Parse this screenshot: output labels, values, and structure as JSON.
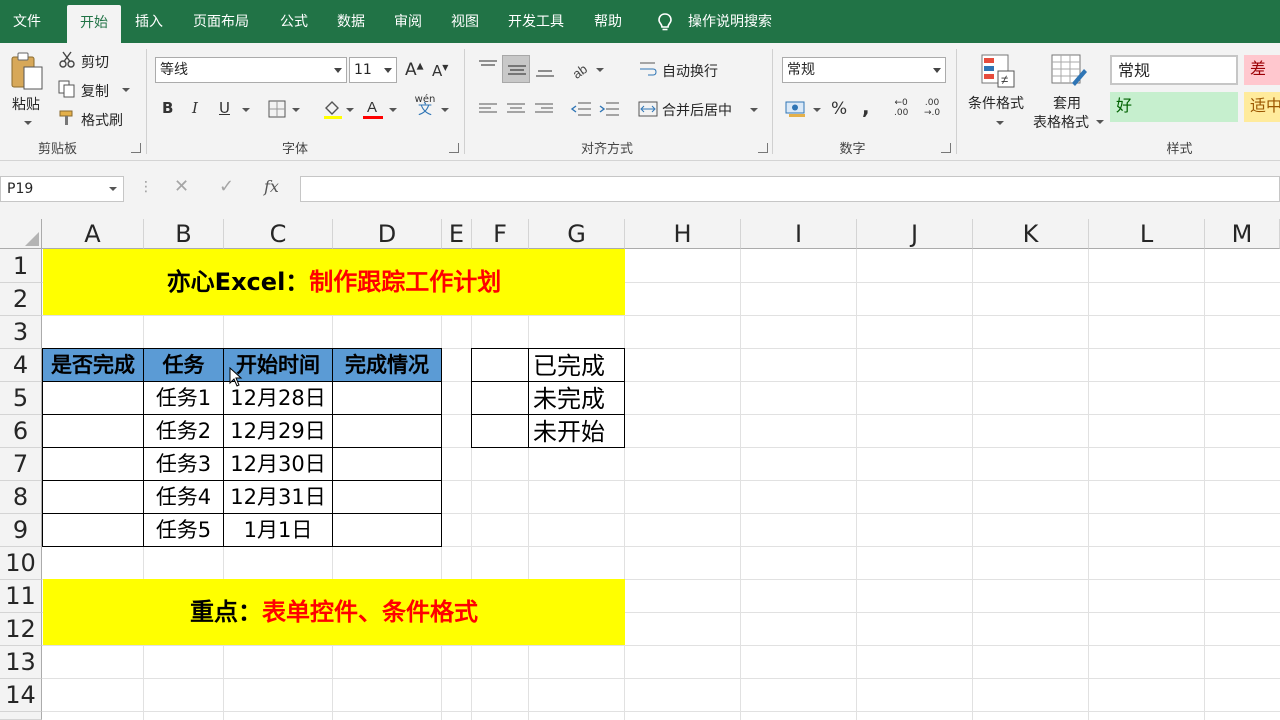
{
  "tabs": [
    "文件",
    "开始",
    "插入",
    "页面布局",
    "公式",
    "数据",
    "审阅",
    "视图",
    "开发工具",
    "帮助"
  ],
  "active_tab": "开始",
  "tell_me": "操作说明搜索",
  "ribbon": {
    "clipboard": {
      "paste": "粘贴",
      "cut": "剪切",
      "copy": "复制",
      "format_painter": "格式刷",
      "label": "剪贴板"
    },
    "font": {
      "name": "等线",
      "size": "11",
      "bold": "B",
      "italic": "I",
      "underline": "U",
      "label": "字体",
      "phonetic": "wén"
    },
    "alignment": {
      "wrap": "自动换行",
      "merge": "合并后居中",
      "label": "对齐方式"
    },
    "number": {
      "format": "常规",
      "percent": "%",
      "comma": ",",
      "label": "数字"
    },
    "styles": {
      "conditional": "条件格式",
      "table_format_1": "套用",
      "table_format_2": "表格格式",
      "normal": "常规",
      "bad": "差",
      "good": "好",
      "neutral": "适中",
      "label": "样式"
    }
  },
  "formula_bar": {
    "name_box": "P19",
    "fx": "fx",
    "content": ""
  },
  "columns": [
    "A",
    "B",
    "C",
    "D",
    "E",
    "F",
    "G",
    "H",
    "I",
    "J",
    "K",
    "L",
    "M"
  ],
  "rows": [
    "1",
    "2",
    "3",
    "4",
    "5",
    "6",
    "7",
    "8",
    "9",
    "10",
    "11",
    "12",
    "13",
    "14"
  ],
  "title_banner": {
    "black": "亦心Excel：",
    "red": "制作跟踪工作计划"
  },
  "table": {
    "headers": [
      "是否完成",
      "任务",
      "开始时间",
      "完成情况"
    ],
    "rows": [
      [
        "",
        "任务1",
        "12月28日",
        ""
      ],
      [
        "",
        "任务2",
        "12月29日",
        ""
      ],
      [
        "",
        "任务3",
        "12月30日",
        ""
      ],
      [
        "",
        "任务4",
        "12月31日",
        ""
      ],
      [
        "",
        "任务5",
        "1月1日",
        ""
      ]
    ]
  },
  "status_list": [
    "已完成",
    "未完成",
    "未开始"
  ],
  "focus_banner": {
    "black": "重点：",
    "red": "表单控件、条件格式"
  },
  "colors": {
    "ribbon_green": "#217346",
    "header_blue": "#5b9bd5",
    "banner_yellow": "#ffff00",
    "accent_red": "#ff0000"
  }
}
